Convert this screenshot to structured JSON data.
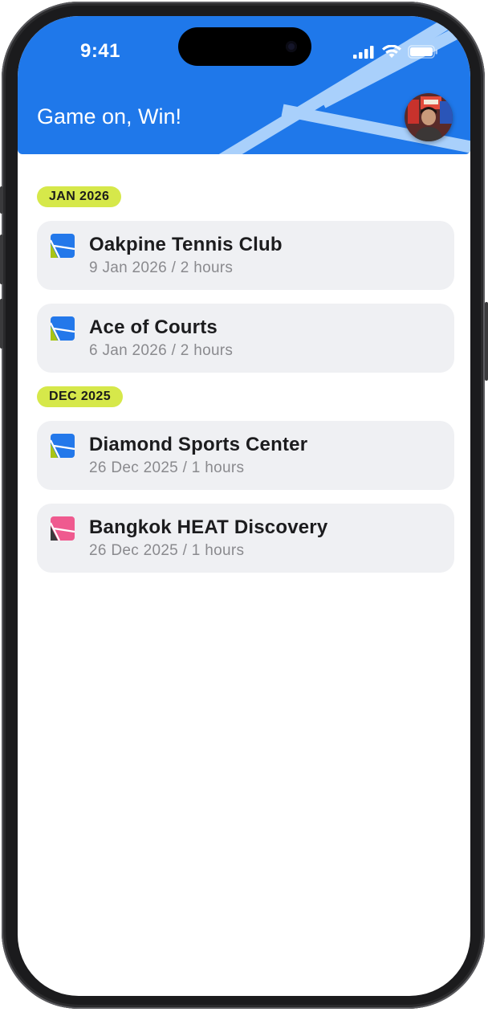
{
  "status_bar": {
    "time": "9:41"
  },
  "header": {
    "greeting": "Game on, Win!",
    "background_color": "#1f78ea",
    "avatar_icon": "user-avatar-photo"
  },
  "groups": [
    {
      "month": "JAN 2026",
      "bookings": [
        {
          "venue": "Oakpine Tennis Club",
          "details": "9 Jan 2026 / 2 hours",
          "icon": "court-logo-blue-green"
        },
        {
          "venue": "Ace of Courts",
          "details": "6 Jan 2026 / 2 hours",
          "icon": "court-logo-blue-green"
        }
      ]
    },
    {
      "month": "DEC 2025",
      "bookings": [
        {
          "venue": "Diamond Sports Center",
          "details": "26 Dec 2025 / 1 hours",
          "icon": "court-logo-blue-green"
        },
        {
          "venue": "Bangkok HEAT Discovery",
          "details": "26 Dec 2025 / 1 hours",
          "icon": "court-logo-pink-black"
        }
      ]
    }
  ],
  "colors": {
    "accent_blue": "#1f78ea",
    "badge_lime": "#d6e84a",
    "card_bg": "#eff0f3",
    "logo_blue": "#2378ea",
    "logo_green": "#a8c414",
    "logo_pink": "#ef5a8f",
    "logo_dark": "#3a3a3c"
  }
}
